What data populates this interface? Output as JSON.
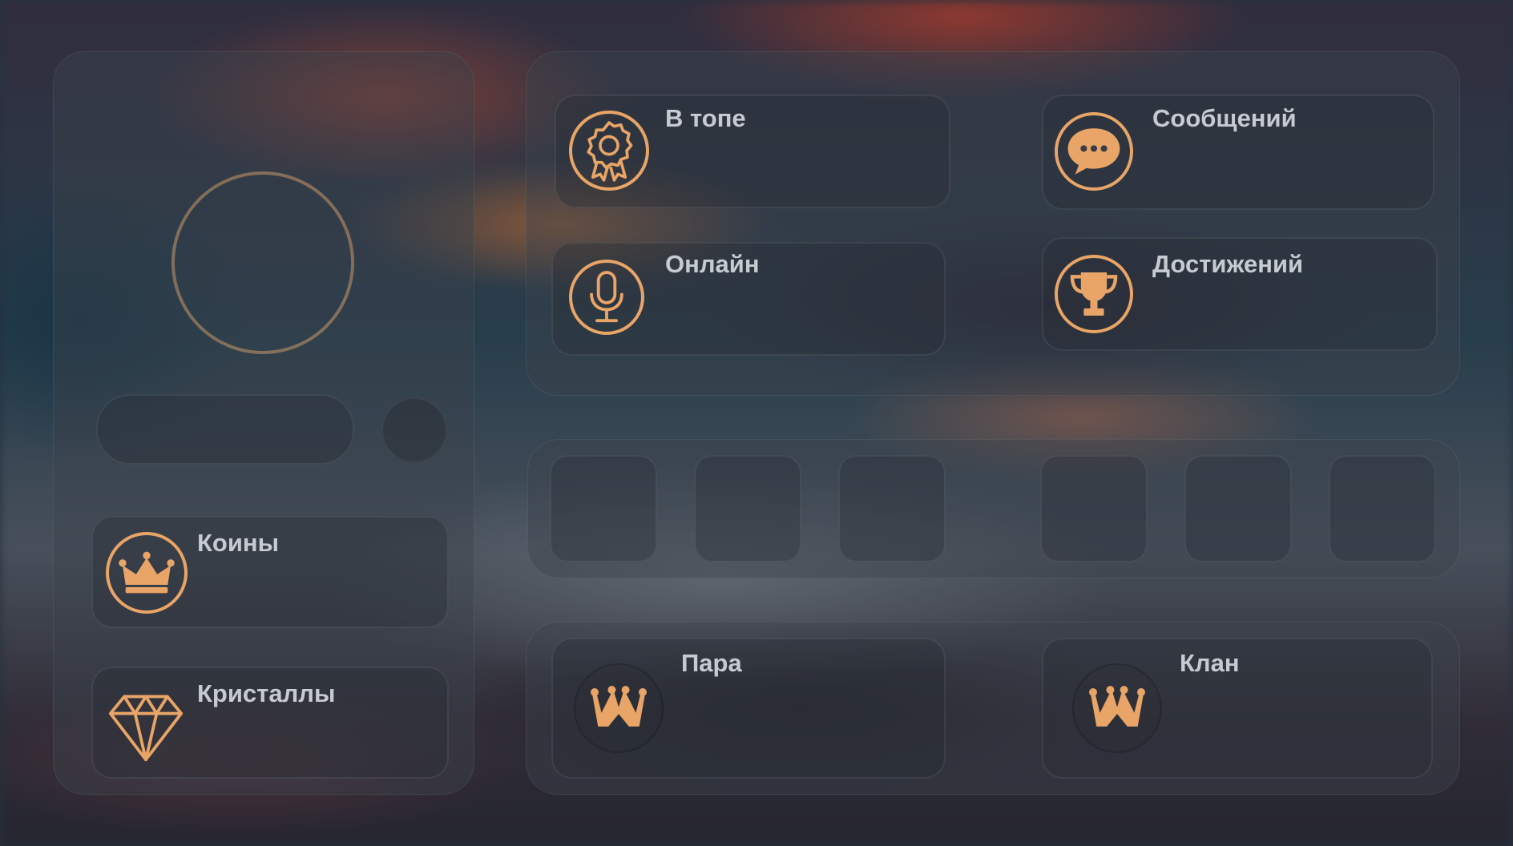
{
  "profile": {
    "coins_label": "Коины",
    "crystals_label": "Кристаллы"
  },
  "stats": {
    "top_label": "В топе",
    "messages_label": "Сообщений",
    "online_label": "Онлайн",
    "achievements_label": "Достижений"
  },
  "relations": {
    "pair_label": "Пара",
    "clan_label": "Клан"
  },
  "icons": {
    "top": "award-ribbon-icon",
    "messages": "chat-bubble-icon",
    "online": "microphone-icon",
    "achievements": "trophy-icon",
    "coins": "crown-icon",
    "crystals": "diamond-icon",
    "pair": "clan-crown-icon",
    "clan": "clan-crown-icon"
  },
  "colors": {
    "accent": "#e8a567",
    "label": "#c6cbd1"
  }
}
